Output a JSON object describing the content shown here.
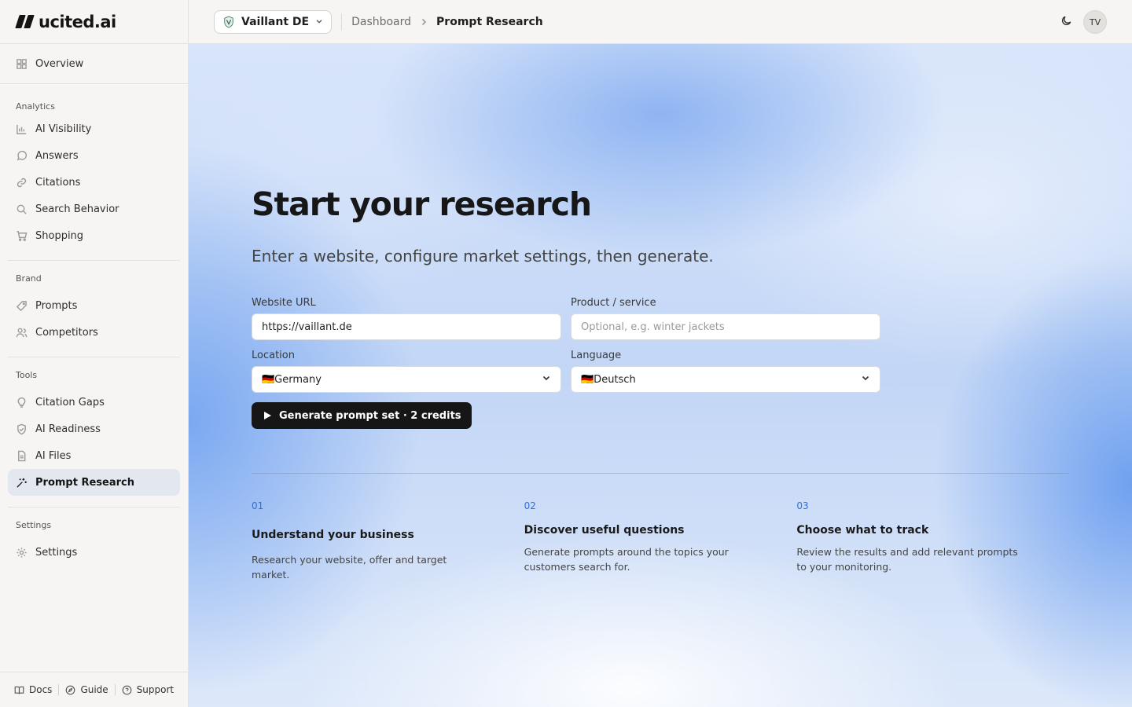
{
  "app": {
    "logo_text": "ucited.ai"
  },
  "header": {
    "brand": "Vaillant DE",
    "breadcrumb": [
      "Dashboard",
      "Prompt Research"
    ],
    "avatar": "TV"
  },
  "sidebar": {
    "overview": "Overview",
    "sections": [
      {
        "label": "Analytics",
        "items": [
          "AI Visibility",
          "Answers",
          "Citations",
          "Search Behavior",
          "Shopping"
        ]
      },
      {
        "label": "Brand",
        "items": [
          "Prompts",
          "Competitors"
        ]
      },
      {
        "label": "Tools",
        "items": [
          "Citation Gaps",
          "AI Readiness",
          "AI Files",
          "Prompt Research"
        ]
      },
      {
        "label": "Settings",
        "items": [
          "Settings"
        ]
      }
    ],
    "active": "Prompt Research",
    "footer": [
      "Docs",
      "Guide",
      "Support"
    ]
  },
  "main": {
    "title": "Start your research",
    "subtitle": "Enter a website, configure market settings, then generate.",
    "fields": {
      "website": {
        "label": "Website URL",
        "value": "https://vaillant.de"
      },
      "product": {
        "label": "Product / service",
        "placeholder": "Optional, e.g. winter jackets"
      },
      "location": {
        "label": "Location",
        "value": "🇩🇪Germany"
      },
      "language": {
        "label": "Language",
        "value": "🇩🇪Deutsch"
      }
    },
    "generate_button": "Generate prompt set · 2 credits",
    "steps": [
      {
        "num": "01",
        "title": "Understand your business",
        "desc": "Research your website, offer and target market."
      },
      {
        "num": "02",
        "title": "Discover useful questions",
        "desc": "Generate prompts around the topics your customers search for."
      },
      {
        "num": "03",
        "title": "Choose what to track",
        "desc": "Review the results and add relevant prompts to your monitoring."
      }
    ]
  },
  "colors": {
    "accent": "#2f6fe0",
    "button": "#161616",
    "active_nav": "#e3e8f0"
  }
}
